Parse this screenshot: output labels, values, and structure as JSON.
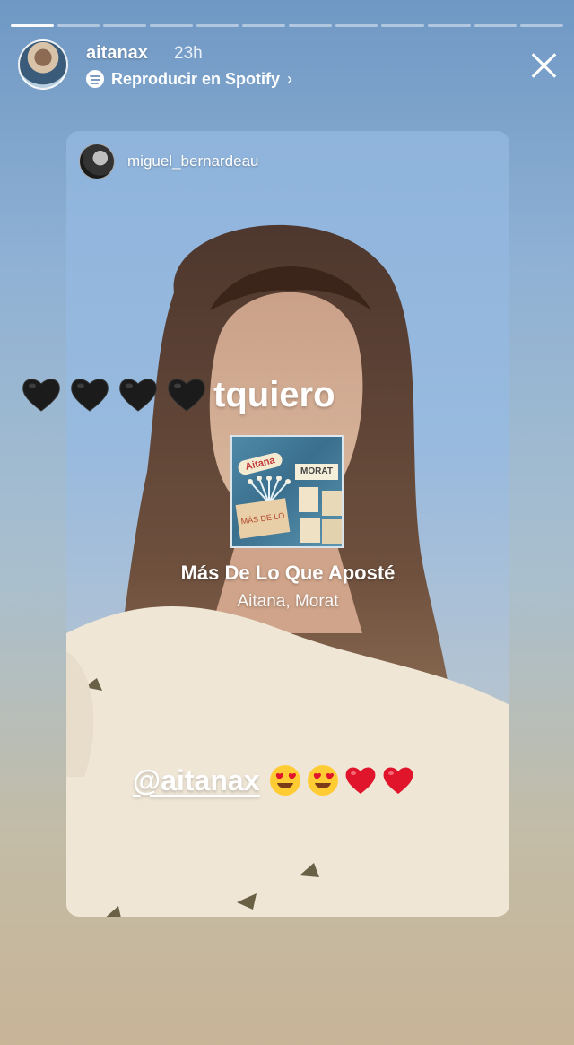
{
  "progress": {
    "segments": 12,
    "active_index": 0
  },
  "header": {
    "username": "aitanax",
    "time": "23h",
    "spotify_label": "Reproducir en Spotify",
    "chevron": "›"
  },
  "card": {
    "author_username": "miguel_bernardeau",
    "caption_text": "tquiero",
    "black_hearts_count": 4,
    "album": {
      "tag_left": "Aitana",
      "tag_right": "MORAT",
      "ticket": "MÁS DE LO QUE APOSTÉ"
    },
    "song_title": "Más De Lo Que Aposté",
    "song_artist": "Aitana, Morat",
    "mention": "@aitanax",
    "emojis": [
      "heart-eyes",
      "heart-eyes",
      "red-heart",
      "red-heart"
    ]
  },
  "colors": {
    "story_top": "#6f98c4",
    "story_bottom": "#c8b497",
    "red_heart": "#e0142b",
    "black_heart": "#1b1b1b",
    "emoji_yellow": "#ffcc33"
  }
}
